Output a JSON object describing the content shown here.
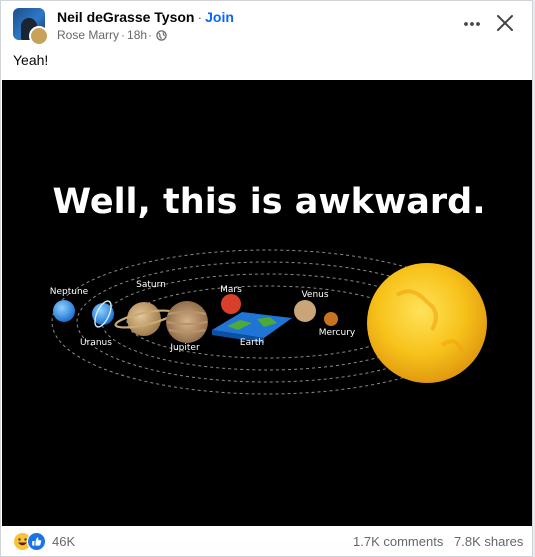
{
  "post": {
    "group_name": "Neil deGrasse Tyson",
    "separator": "·",
    "join_label": "Join",
    "author": "Rose Marry",
    "time": "18h",
    "text": "Yeah!"
  },
  "image": {
    "headline": "Well, this is awkward.",
    "planets": {
      "neptune": "Neptune",
      "uranus": "Uranus",
      "saturn": "Saturn",
      "jupiter": "Jupiter",
      "mars": "Mars",
      "earth": "Earth",
      "venus": "Venus",
      "mercury": "Mercury"
    }
  },
  "footer": {
    "reaction_count": "46K",
    "comments": "1.7K comments",
    "shares": "7.8K shares"
  },
  "icons": {
    "more": "more-horizontal-icon",
    "close": "close-icon",
    "privacy": "globe-icon",
    "reaction_1": "haha-reaction-icon",
    "reaction_2": "like-reaction-icon"
  },
  "colors": {
    "link": "#0866ff",
    "secondary_text": "#65676b",
    "primary_text": "#050505",
    "like_blue": "#1b74e4",
    "haha_yellow": "#f7c33c"
  }
}
